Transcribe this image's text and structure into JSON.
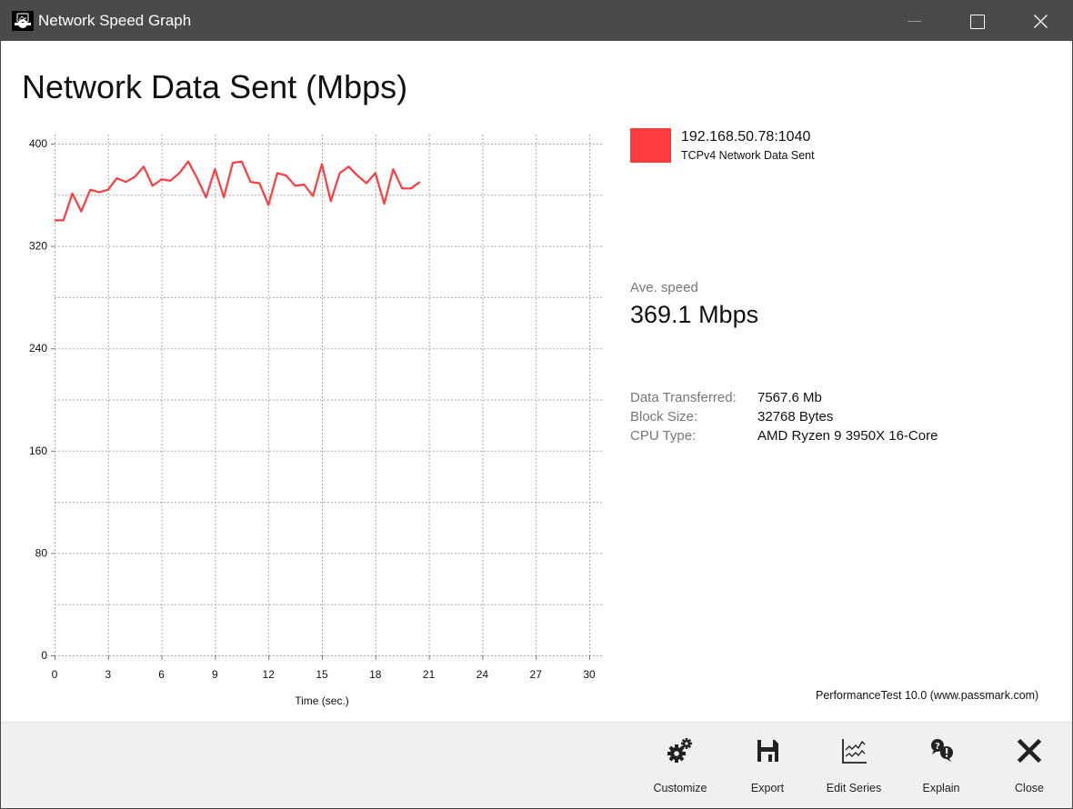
{
  "window": {
    "title": "Network Speed Graph",
    "controls": [
      "minimize",
      "maximize",
      "close"
    ]
  },
  "chart_title": "Network Data Sent (Mbps)",
  "legend": {
    "color": "#ff3b3f",
    "name": "192.168.50.78:1040",
    "description": "TCPv4 Network Data Sent"
  },
  "average": {
    "label": "Ave. speed",
    "value": "369.1 Mbps"
  },
  "stats": [
    {
      "key": "Data Transferred:",
      "value": "7567.6 Mb"
    },
    {
      "key": "Block Size:",
      "value": "32768 Bytes"
    },
    {
      "key": "CPU Type:",
      "value": "AMD Ryzen 9 3950X 16-Core"
    }
  ],
  "credit": "PerformanceTest 10.0 (www.passmark.com)",
  "toolbar": [
    {
      "id": "customize",
      "label": "Customize",
      "icon": "gears-icon"
    },
    {
      "id": "export",
      "label": "Export",
      "icon": "floppy-disk-icon"
    },
    {
      "id": "edit-series",
      "label": "Edit Series",
      "icon": "line-chart-icon"
    },
    {
      "id": "explain",
      "label": "Explain",
      "icon": "question-exclamation-bubbles-icon"
    },
    {
      "id": "close",
      "label": "Close",
      "icon": "close-x-icon"
    }
  ],
  "chart_data": {
    "type": "line",
    "title": "Network Data Sent (Mbps)",
    "xlabel": "Time (sec.)",
    "ylabel": "",
    "xlim": [
      0,
      30
    ],
    "ylim": [
      0,
      400
    ],
    "x_ticks": [
      0,
      3,
      6,
      9,
      12,
      15,
      18,
      21,
      24,
      27,
      30
    ],
    "y_ticks": [
      0,
      80,
      160,
      240,
      320,
      400
    ],
    "y_minor_grid_step": 40,
    "grid": true,
    "legend_position": "right",
    "series": [
      {
        "name": "192.168.50.78:1040",
        "color": "#ff3b3f",
        "x": [
          0,
          0.5,
          1,
          1.5,
          2,
          2.5,
          3,
          3.5,
          4,
          4.5,
          5,
          5.5,
          6,
          6.5,
          7,
          7.5,
          8,
          8.5,
          9,
          9.5,
          10,
          10.5,
          11,
          11.5,
          12,
          12.5,
          13,
          13.5,
          14,
          14.5,
          15,
          15.5,
          16,
          16.5,
          17,
          17.5,
          18,
          18.5,
          19,
          19.5,
          20,
          20.5
        ],
        "values": [
          340,
          340,
          361,
          347,
          364,
          362,
          364,
          373,
          370,
          374,
          382,
          367,
          372,
          371,
          377,
          386,
          373,
          358,
          380,
          358,
          385,
          386,
          370,
          369,
          352,
          377,
          375,
          367,
          368,
          359,
          384,
          355,
          377,
          382,
          375,
          369,
          377,
          353,
          380,
          365,
          365,
          370
        ]
      }
    ]
  }
}
